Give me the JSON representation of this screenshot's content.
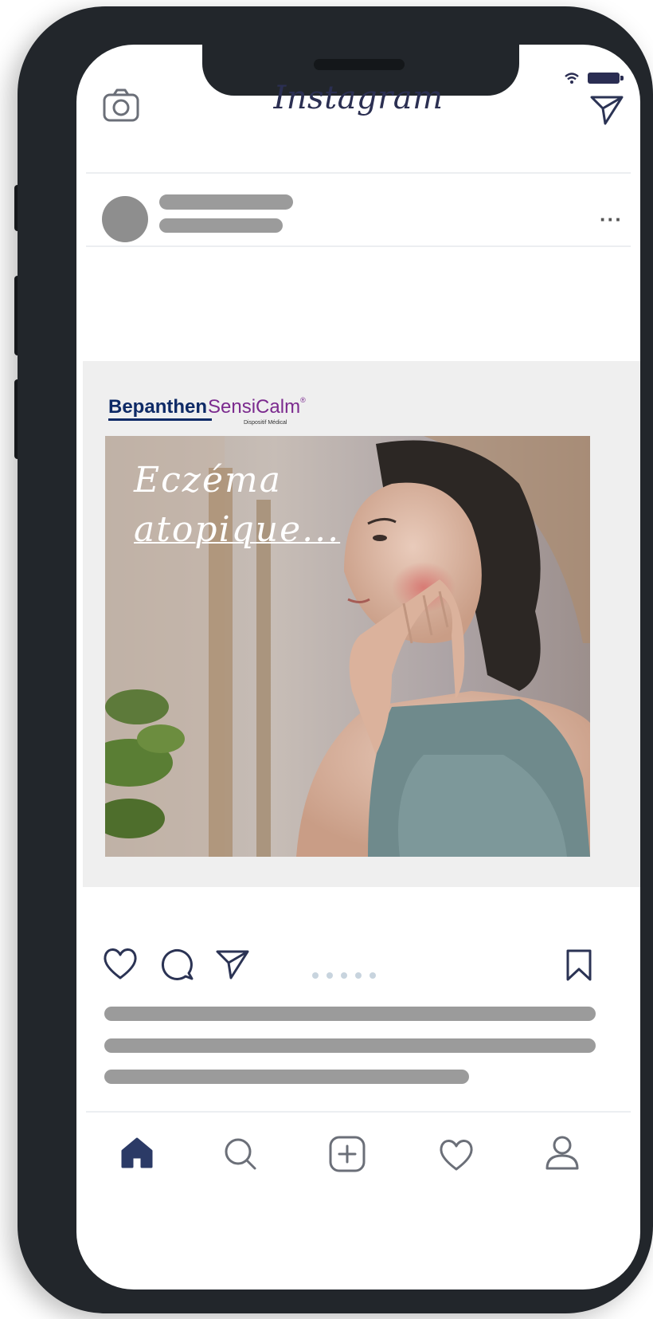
{
  "app": {
    "title": "Instagram"
  },
  "post": {
    "brand": {
      "name_part1": "Bepanthen",
      "name_part2": "SensiCalm",
      "registered": "®",
      "subtitle": "Dispositif Médical"
    },
    "overlay_text": {
      "line1": "Eczéma",
      "line2": "atopique..."
    },
    "carousel_count": 5
  },
  "colors": {
    "brand_blue": "#0e2a66",
    "brand_purple": "#7b2a8e",
    "nav_active": "#2b3a66",
    "icon_stroke": "#2b3354"
  },
  "icons": {
    "top_left": "camera-icon",
    "top_right": "direct-message-icon",
    "post_menu": "more-icon",
    "actions": [
      "heart-icon",
      "comment-icon",
      "share-icon",
      "bookmark-icon"
    ],
    "bottom_nav": [
      "home-icon",
      "search-icon",
      "add-post-icon",
      "activity-icon",
      "profile-icon"
    ]
  }
}
